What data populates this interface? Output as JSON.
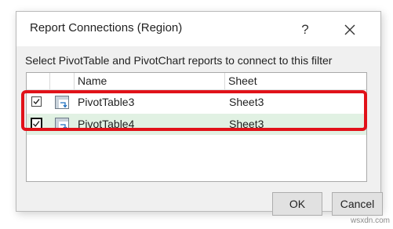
{
  "dialog": {
    "title": "Report Connections (Region)",
    "help_label": "?",
    "instructions": "Select PivotTable and PivotChart reports to connect to this filter"
  },
  "list": {
    "columns": [
      "Name",
      "Sheet"
    ],
    "rows": [
      {
        "name": "PivotTable3",
        "sheet": "Sheet3",
        "checked": true
      },
      {
        "name": "PivotTable4",
        "sheet": "Sheet3",
        "checked": true
      }
    ],
    "highlight_color": "#e11219",
    "selected_row_color": "#e1f1e3"
  },
  "buttons": {
    "ok": "OK",
    "cancel": "Cancel"
  },
  "watermark": "wsxdn.com"
}
